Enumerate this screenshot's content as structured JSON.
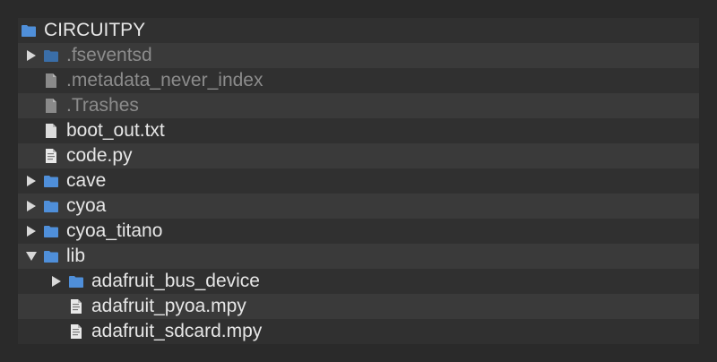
{
  "colors": {
    "folder": "#4f8fd9",
    "folder_dim": "#3b6ea8",
    "file": "#dcdcdc",
    "file_dim": "#8a8a8a",
    "text": "#e6e6e6",
    "text_dim": "#8c8c8c"
  },
  "tree": {
    "items": [
      {
        "label": "CIRCUITPY",
        "icon": "folder-icon",
        "depth": 0,
        "toggle": "none"
      },
      {
        "label": ".fseventsd",
        "icon": "folder-icon",
        "depth": 1,
        "toggle": "collapsed",
        "hidden": true
      },
      {
        "label": ".metadata_never_index",
        "icon": "file-icon",
        "depth": 1,
        "toggle": "none",
        "hidden": true
      },
      {
        "label": ".Trashes",
        "icon": "file-icon",
        "depth": 1,
        "toggle": "none",
        "hidden": true
      },
      {
        "label": "boot_out.txt",
        "icon": "file-icon",
        "depth": 1,
        "toggle": "none"
      },
      {
        "label": "code.py",
        "icon": "code-file-icon",
        "depth": 1,
        "toggle": "none"
      },
      {
        "label": "cave",
        "icon": "folder-icon",
        "depth": 1,
        "toggle": "collapsed"
      },
      {
        "label": "cyoa",
        "icon": "folder-icon",
        "depth": 1,
        "toggle": "collapsed"
      },
      {
        "label": "cyoa_titano",
        "icon": "folder-icon",
        "depth": 1,
        "toggle": "collapsed"
      },
      {
        "label": "lib",
        "icon": "folder-icon",
        "depth": 1,
        "toggle": "expanded"
      },
      {
        "label": "adafruit_bus_device",
        "icon": "folder-icon",
        "depth": 2,
        "toggle": "collapsed"
      },
      {
        "label": "adafruit_pyoa.mpy",
        "icon": "code-file-icon",
        "depth": 2,
        "toggle": "none"
      },
      {
        "label": "adafruit_sdcard.mpy",
        "icon": "code-file-icon",
        "depth": 2,
        "toggle": "none"
      }
    ]
  }
}
